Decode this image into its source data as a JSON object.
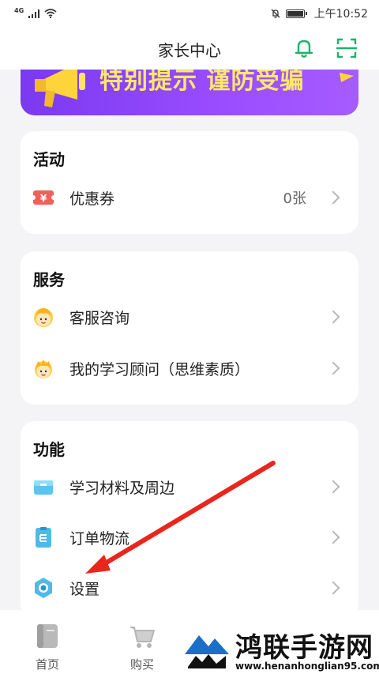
{
  "status_bar": {
    "network": "4G",
    "time": "上午10:52"
  },
  "header": {
    "title": "家长中心",
    "icons": [
      "bell-icon",
      "scan-icon"
    ],
    "accent_color": "#1db26b"
  },
  "banner": {
    "text": "特别提示 谨防受骗",
    "text_color": "#ffe86a",
    "background_color": "#8a44f8"
  },
  "sections": {
    "activities": {
      "title": "活动",
      "items": [
        {
          "label": "优惠券",
          "value": "0张",
          "icon": "coupon-icon"
        }
      ]
    },
    "services": {
      "title": "服务",
      "items": [
        {
          "label": "客服咨询",
          "icon": "customer-service-avatar-icon"
        },
        {
          "label": "我的学习顾问（思维素质）",
          "icon": "study-advisor-avatar-icon"
        }
      ]
    },
    "functions": {
      "title": "功能",
      "items": [
        {
          "label": "学习材料及周边",
          "icon": "materials-box-icon"
        },
        {
          "label": "订单物流",
          "icon": "order-logistics-icon"
        },
        {
          "label": "设置",
          "icon": "settings-icon"
        }
      ]
    }
  },
  "tabbar": {
    "tabs": [
      {
        "label": "首页",
        "icon": "home-book-icon"
      },
      {
        "label": "购买",
        "icon": "cart-icon"
      }
    ]
  },
  "watermark": {
    "title": "鸿联手游网",
    "url": "www.henanhonglian95.com"
  },
  "annotation": {
    "arrow_color": "#e8261c"
  }
}
